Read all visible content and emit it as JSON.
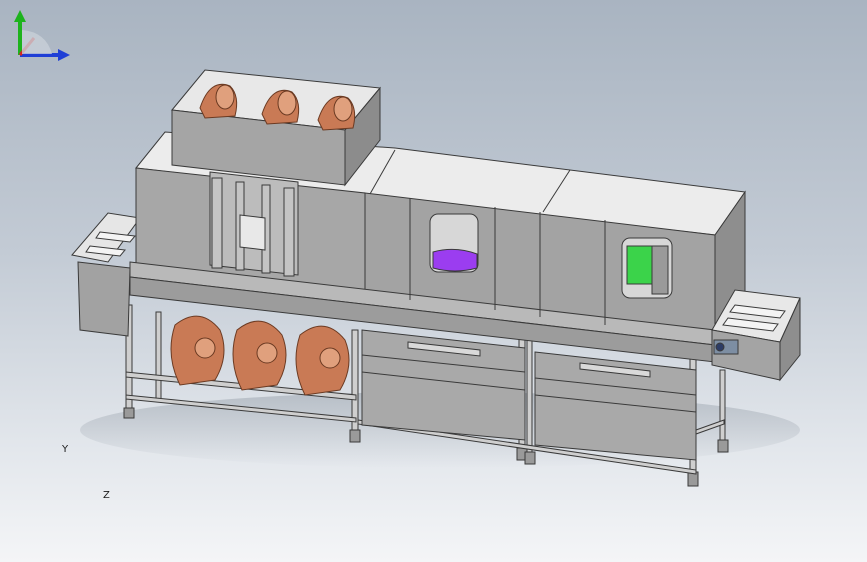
{
  "viewport": {
    "background_top": "#a9b4c1",
    "background_bottom": "#f4f5f7"
  },
  "model": {
    "body_color": "#a7a7a7",
    "body_light": "#e2e2e2",
    "body_dark": "#8e8e8e",
    "outline_color": "#3a3a3a",
    "fan_color": "#c97a55",
    "window_left_fill": "#9b3df0",
    "window_right_fill": "#3bd34a"
  },
  "triad": {
    "y_label": "Y",
    "z_label": "Z",
    "y_color": "#1db31d",
    "z_color": "#1f3fd6",
    "x_color": "#d6261f"
  }
}
